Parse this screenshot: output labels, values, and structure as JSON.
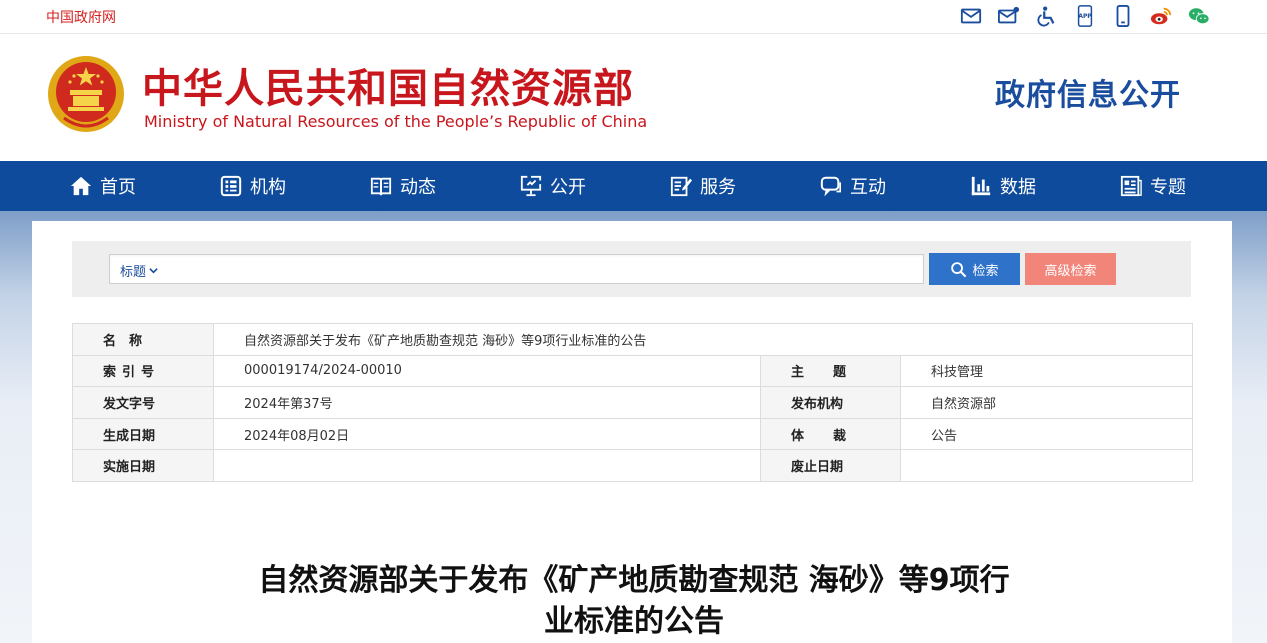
{
  "topbar": {
    "gov_link": "中国政府网",
    "icon_app_label": "APP"
  },
  "header": {
    "title_cn": "中华人民共和国自然资源部",
    "title_en": "Ministry of Natural Resources of the People’s Republic of China",
    "section_title": "政府信息公开"
  },
  "nav": {
    "items": [
      {
        "label": "首页",
        "icon": "home-icon"
      },
      {
        "label": "机构",
        "icon": "organization-icon"
      },
      {
        "label": "动态",
        "icon": "book-icon"
      },
      {
        "label": "公开",
        "icon": "monitor-icon"
      },
      {
        "label": "服务",
        "icon": "edit-document-icon"
      },
      {
        "label": "互动",
        "icon": "chat-icon"
      },
      {
        "label": "数据",
        "icon": "bar-chart-icon"
      },
      {
        "label": "专题",
        "icon": "topic-document-icon"
      }
    ]
  },
  "search": {
    "select_label": "标题",
    "input_value": "",
    "search_button": "检索",
    "advanced_button": "高级检索"
  },
  "info": {
    "name_label": "名　称",
    "name_value": "自然资源部关于发布《矿产地质勘查规范 海砂》等9项行业标准的公告",
    "index_label": "索引号",
    "index_value": "000019174/2024-00010",
    "theme_label": "主题",
    "theme_value": "科技管理",
    "docno_label": "发文字号",
    "docno_value": "2024年第37号",
    "issuer_label": "发布机构",
    "issuer_value": "自然资源部",
    "created_label": "生成日期",
    "created_value": "2024年08月02日",
    "genre_label": "体裁",
    "genre_value": "公告",
    "effective_label": "实施日期",
    "effective_value": "",
    "abolished_label": "废止日期",
    "abolished_value": ""
  },
  "article": {
    "title_line1": "自然资源部关于发布《矿产地质勘查规范 海砂》等9项行",
    "title_line2": "业标准的公告"
  },
  "colors": {
    "brand_red": "#c8161d",
    "nav_blue": "#0e4b9c",
    "search_blue": "#2f72c9",
    "advanced_salmon": "#f2857a"
  }
}
